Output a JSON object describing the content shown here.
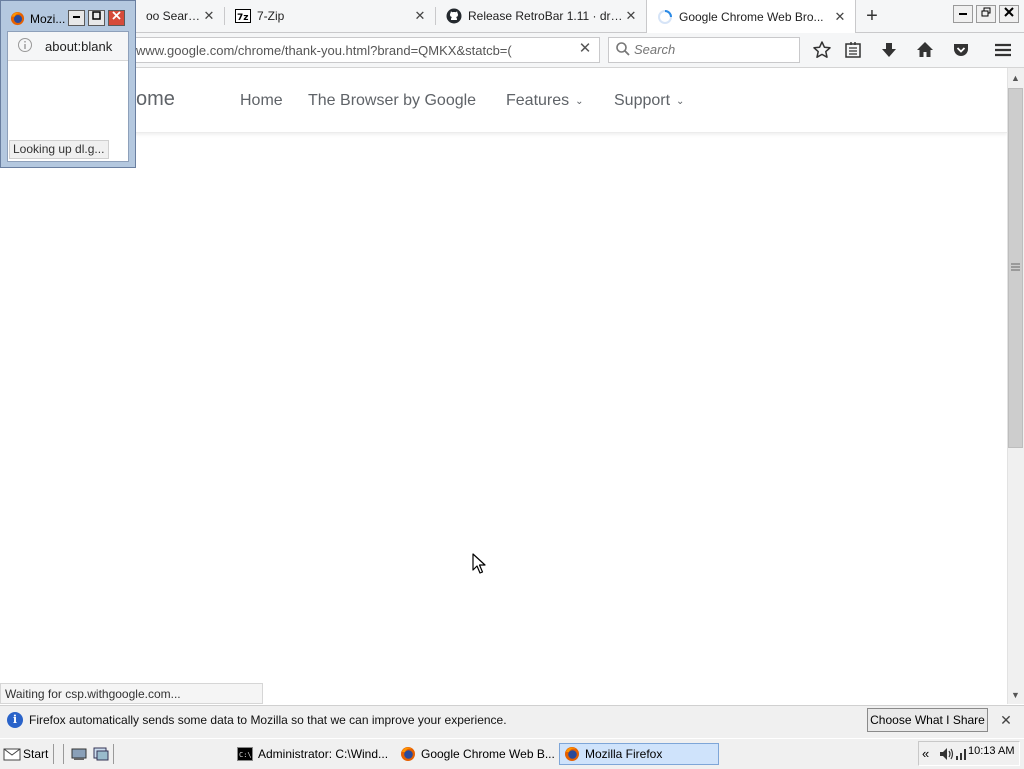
{
  "browser": {
    "tabs": [
      {
        "title": "oo Searc..."
      },
      {
        "title": "7-Zip"
      },
      {
        "title": "Release RetroBar 1.11 · dre..."
      },
      {
        "title": "Google Chrome Web Bro..."
      }
    ],
    "new_tab_symbol": "+",
    "url": "www.google.com/chrome/thank-you.html?brand=QMKX&statcb=(",
    "search_placeholder": "Search"
  },
  "site": {
    "brand_partial": "ome",
    "nav": [
      "Home",
      "The Browser by Google",
      "Features",
      "Support"
    ]
  },
  "status_text": "Waiting for csp.withgoogle.com...",
  "notification": {
    "message": "Firefox automatically sends some data to Mozilla so that we can improve your experience.",
    "button": "Choose What I Share"
  },
  "mini_window": {
    "title": "Mozi...",
    "url": "about:blank",
    "status": "Looking up dl.g..."
  },
  "taskbar": {
    "start_label": "Start",
    "tasks": [
      {
        "label": "Administrator: C:\\Wind..."
      },
      {
        "label": "Google Chrome Web B..."
      },
      {
        "label": "Mozilla Firefox"
      }
    ],
    "clock": "10:13 AM"
  },
  "colors": {
    "accent": "#2a63c9",
    "active_task": "#cfe3fb"
  }
}
